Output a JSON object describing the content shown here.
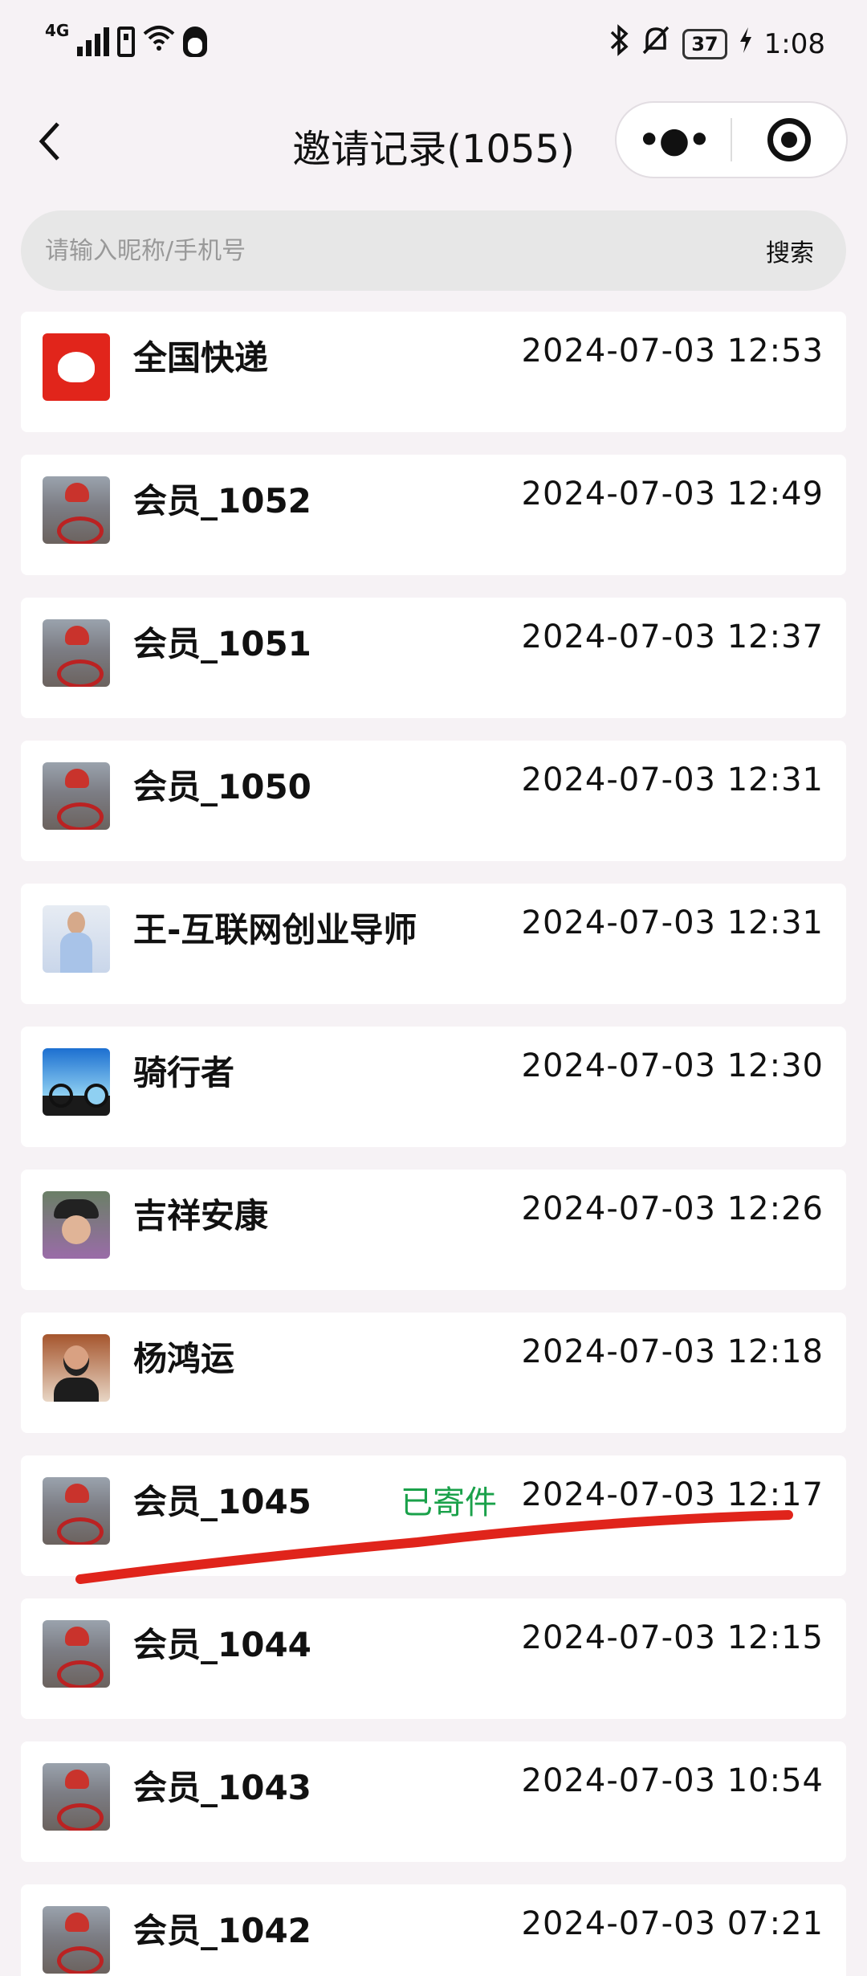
{
  "status_bar": {
    "network": "4G",
    "battery": "37",
    "time": "1:08"
  },
  "nav": {
    "title": "邀请记录(1055)"
  },
  "search": {
    "placeholder": "请输入昵称/手机号",
    "button_label": "搜索"
  },
  "records": [
    {
      "name": "全国快递",
      "time": "2024-07-03 12:53",
      "tag": ""
    },
    {
      "name": "会员_1052",
      "time": "2024-07-03 12:49",
      "tag": ""
    },
    {
      "name": "会员_1051",
      "time": "2024-07-03 12:37",
      "tag": ""
    },
    {
      "name": "会员_1050",
      "time": "2024-07-03 12:31",
      "tag": ""
    },
    {
      "name": "王-互联网创业导师",
      "time": "2024-07-03 12:31",
      "tag": ""
    },
    {
      "name": "骑行者",
      "time": "2024-07-03 12:30",
      "tag": ""
    },
    {
      "name": "吉祥安康",
      "time": "2024-07-03 12:26",
      "tag": ""
    },
    {
      "name": "杨鸿运",
      "time": "2024-07-03 12:18",
      "tag": ""
    },
    {
      "name": "会员_1045",
      "time": "2024-07-03 12:17",
      "tag": "已寄件"
    },
    {
      "name": "会员_1044",
      "time": "2024-07-03 12:15",
      "tag": ""
    },
    {
      "name": "会员_1043",
      "time": "2024-07-03 10:54",
      "tag": ""
    },
    {
      "name": "会员_1042",
      "time": "2024-07-03 07:21",
      "tag": ""
    }
  ],
  "colors": {
    "tag_green": "#1aa14a",
    "annotation_red": "#e0241b",
    "page_bg": "#f6f2f5"
  }
}
